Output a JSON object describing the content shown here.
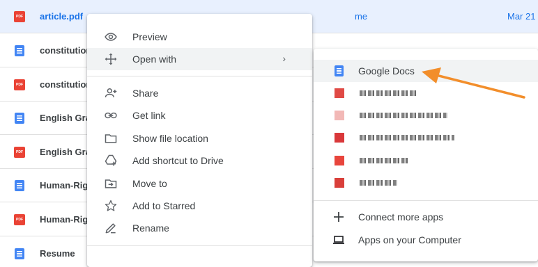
{
  "files": [
    {
      "name": "article.pdf",
      "type": "pdf",
      "owner": "me",
      "modified": "Mar 21",
      "selected": true
    },
    {
      "name": "constitution",
      "type": "doc",
      "owner": "",
      "modified": "",
      "selected": false
    },
    {
      "name": "constitution",
      "type": "pdf",
      "owner": "",
      "modified": "",
      "selected": false
    },
    {
      "name": "English Gra",
      "type": "doc",
      "owner": "",
      "modified": "",
      "selected": false
    },
    {
      "name": "English Gra",
      "type": "pdf",
      "owner": "",
      "modified": "",
      "selected": false
    },
    {
      "name": "Human-Righ",
      "type": "doc",
      "owner": "",
      "modified": "",
      "selected": false
    },
    {
      "name": "Human-Righ",
      "type": "pdf",
      "owner": "",
      "modified": "",
      "selected": false
    },
    {
      "name": "Resume",
      "type": "doc",
      "owner": "",
      "modified": "",
      "selected": false
    }
  ],
  "context_menu": {
    "items": [
      {
        "label": "Preview",
        "icon": "eye-icon"
      },
      {
        "label": "Open with",
        "icon": "move-arrows-icon",
        "has_submenu": true,
        "arrow": "›"
      },
      {
        "label": "Share",
        "icon": "person-add-icon"
      },
      {
        "label": "Get link",
        "icon": "link-icon"
      },
      {
        "label": "Show file location",
        "icon": "folder-icon"
      },
      {
        "label": "Add shortcut to Drive",
        "icon": "drive-add-icon"
      },
      {
        "label": "Move to",
        "icon": "move-to-folder-icon"
      },
      {
        "label": "Add to Starred",
        "icon": "star-icon"
      },
      {
        "label": "Rename",
        "icon": "pencil-icon"
      }
    ]
  },
  "open_with_menu": {
    "google_docs_label": "Google Docs",
    "connect_more_label": "Connect more apps",
    "apps_on_computer_label": "Apps on your Computer"
  },
  "annotation": {
    "arrow_color": "#f28e2b"
  }
}
